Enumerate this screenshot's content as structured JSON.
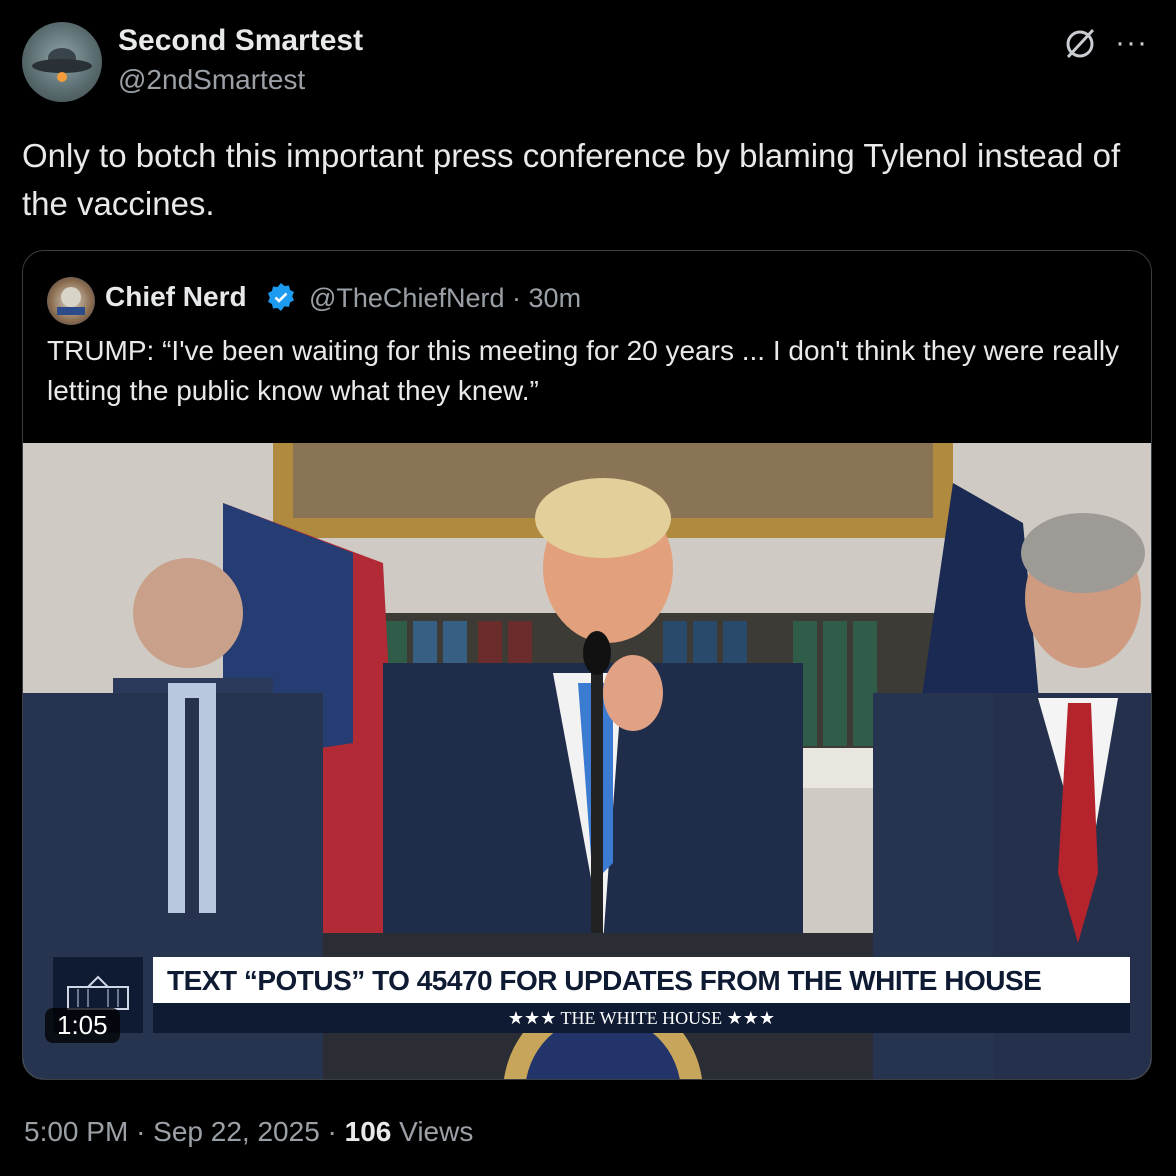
{
  "tweet": {
    "author_name": "Second Smartest",
    "author_handle": "@2ndSmartest",
    "text": "Only to botch this important press conference by blaming Tylenol instead of the vaccines.",
    "time": "5:00 PM",
    "date": "Sep 22, 2025",
    "views_count": "106",
    "views_label": "Views",
    "sep": "·",
    "more": "···"
  },
  "quote": {
    "author_name": "Chief Nerd",
    "author_handle": "@TheChiefNerd",
    "age": "30m",
    "text": "TRUMP: “I've been waiting for this meeting for 20 years ... I don't think they were really letting the public know what they knew.”",
    "video": {
      "duration": "1:05",
      "banner_text": "TEXT “POTUS” TO 45470 FOR UPDATES FROM THE WHITE HOUSE",
      "banner_sub": "★★★ THE WHITE HOUSE ★★★"
    }
  },
  "icons": {
    "grok": "grok-icon",
    "more": "more-icon",
    "verified": "verified-icon"
  },
  "colors": {
    "background": "#000000",
    "text": "#e7e9ea",
    "secondary": "#9aa0a6",
    "verified": "#1d9bf0",
    "banner_navy": "#0e1b33"
  }
}
